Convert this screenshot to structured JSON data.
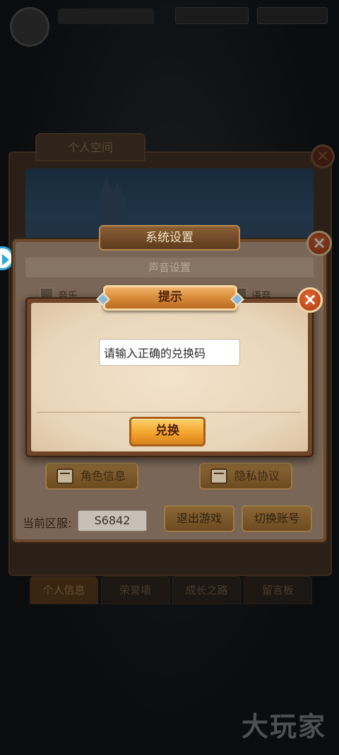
{
  "background": {
    "personal_space_tab": "个人空间",
    "bottom_tabs": [
      "个人信息",
      "荣誉墙",
      "成长之路",
      "留言板"
    ],
    "watermark": "大玩家"
  },
  "settings_dialog": {
    "title": "系统设置",
    "sound_section": "声音设置",
    "music_label": "音乐",
    "voice_label": "语音",
    "role_info_button": "角色信息",
    "privacy_button": "隐私协议",
    "server_label": "当前区服:",
    "server_value": "S6842",
    "quit_button": "退出游戏",
    "switch_account_button": "切换账号"
  },
  "tip_dialog": {
    "title": "提示",
    "input_value": "请输入正确的兑换码",
    "exchange_button": "兑换",
    "close_symbol": "×"
  },
  "colors": {
    "accent": "#f2a52e",
    "close_button": "#d4551f",
    "dialog_bg": "#ecdcc2"
  }
}
